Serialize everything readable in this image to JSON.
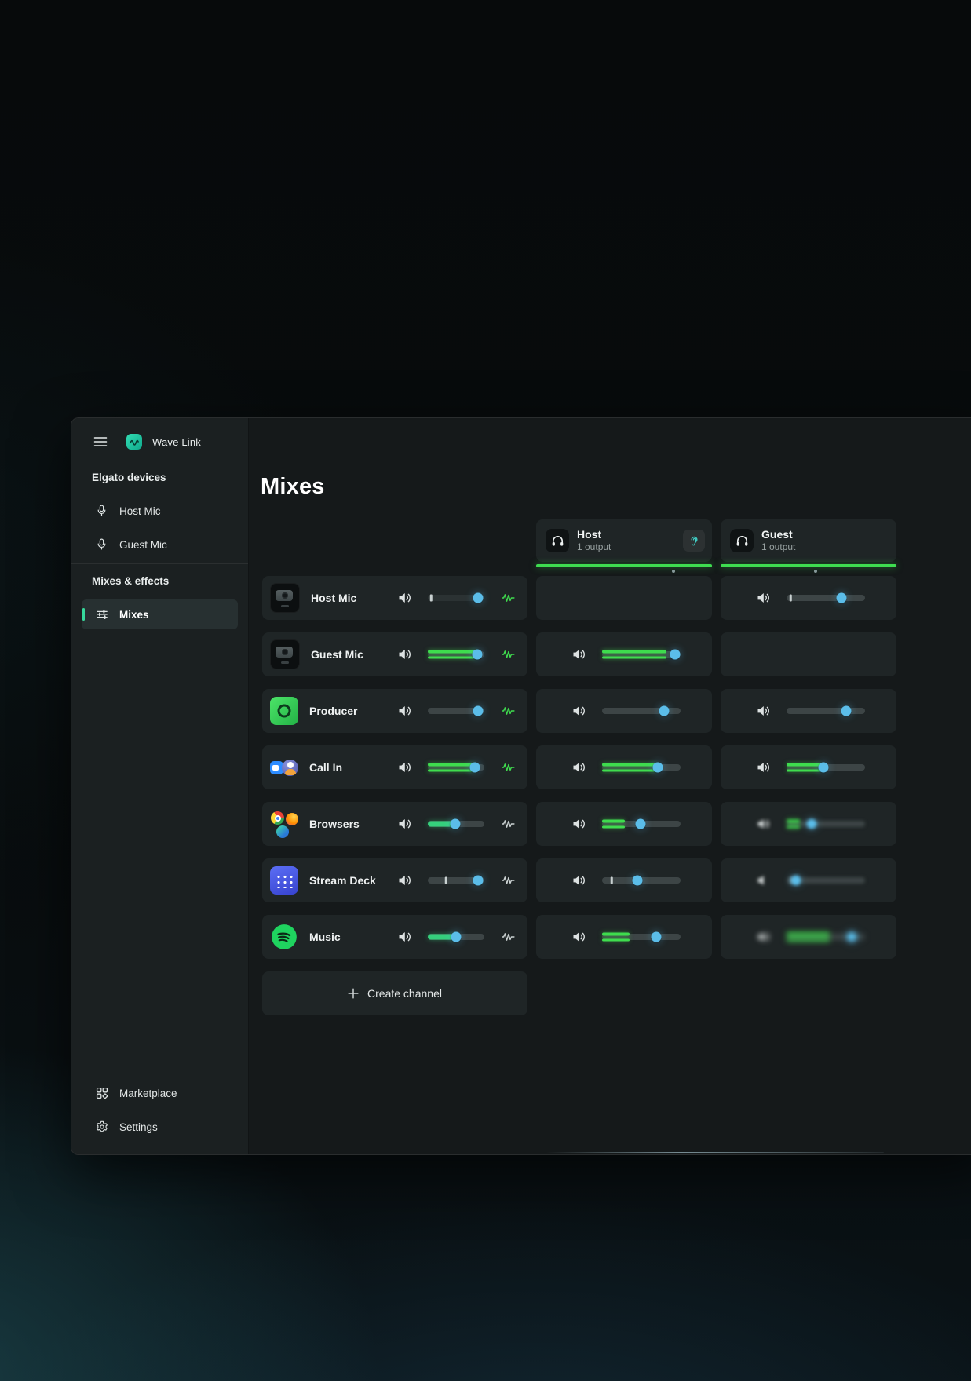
{
  "titlebar": {
    "app_title": "Wave Link"
  },
  "sidebar": {
    "sections": [
      {
        "label": "Elgato devices",
        "items": [
          {
            "label": "Host Mic",
            "icon": "microphone"
          },
          {
            "label": "Guest Mic",
            "icon": "microphone"
          }
        ]
      },
      {
        "label": "Mixes & effects",
        "items": [
          {
            "label": "Mixes",
            "icon": "mixer-sliders",
            "selected": true
          }
        ]
      }
    ],
    "footer_items": [
      {
        "label": "Marketplace",
        "icon": "marketplace"
      },
      {
        "label": "Settings",
        "icon": "gear"
      }
    ]
  },
  "main": {
    "heading": "Mixes",
    "create_channel": {
      "label": "Create channel",
      "icon": "plus"
    },
    "mixes": [
      {
        "name": "Host",
        "subtitle": "1 output",
        "level_percent": 100,
        "marker_percent": 78,
        "monitoring": true
      },
      {
        "name": "Guest",
        "subtitle": "1 output",
        "level_percent": 100,
        "marker_percent": 54,
        "monitoring": false
      }
    ],
    "channels": [
      {
        "name": "Host Mic",
        "icon": "webcam",
        "wave": "green",
        "monitor": {
          "classes": "has-tick dark",
          "tick": 6,
          "knob": 89
        },
        "host": {
          "classes": "empty"
        },
        "guest": {
          "classes": "has-tick",
          "tick": 5,
          "knob": 70
        }
      },
      {
        "name": "Guest Mic",
        "icon": "webcam",
        "wave": "green",
        "monitor": {
          "classes": "has-meter",
          "fill": 86,
          "knob": 88
        },
        "host": {
          "classes": "has-meter",
          "fill": 82,
          "knob": 93
        },
        "guest": {
          "classes": "empty"
        }
      },
      {
        "name": "Producer",
        "icon": "producer",
        "wave": "green",
        "monitor": {
          "classes": "",
          "knob": 89
        },
        "host": {
          "classes": "",
          "knob": 79
        },
        "guest": {
          "classes": "",
          "knob": 76
        }
      },
      {
        "name": "Call In",
        "icon": "callin",
        "wave": "green",
        "monitor": {
          "classes": "has-meter",
          "fill": 82,
          "knob": 84
        },
        "host": {
          "classes": "has-meter",
          "fill": 69,
          "knob": 71
        },
        "guest": {
          "classes": "has-meter",
          "fill": 43,
          "knob": 47
        }
      },
      {
        "name": "Browsers",
        "icon": "browsers",
        "wave": "dim",
        "monitor": {
          "classes": "has-fill",
          "fill": 49,
          "knob": 49
        },
        "host": {
          "classes": "has-meter",
          "fill": 29,
          "knob": 49
        },
        "guest": {
          "classes": "has-meter blur-2",
          "fill": 17,
          "knob": 32
        }
      },
      {
        "name": "Stream Deck",
        "icon": "streamdeck",
        "wave": "dim",
        "monitor": {
          "classes": "has-tick",
          "tick": 32,
          "knob": 89
        },
        "host": {
          "classes": "has-tick",
          "tick": 12,
          "knob": 45
        },
        "guest": {
          "classes": "has-tick blur-2 muted",
          "tick": 6,
          "knob": 12
        }
      },
      {
        "name": "Music",
        "icon": "spotify",
        "wave": "dim",
        "monitor": {
          "classes": "has-fill",
          "fill": 50,
          "knob": 50
        },
        "host": {
          "classes": "has-meter",
          "fill": 35,
          "knob": 69
        },
        "guest": {
          "classes": "has-meter blur-3",
          "fill": 55,
          "knob": 83
        }
      }
    ]
  },
  "colors": {
    "meter_green": "#3fdd4e",
    "fill_teal_green": "#35d07c",
    "knob_blue": "#5bbde9",
    "accent_teal": "#36d99c",
    "window_bg": "#15191a",
    "cell_bg": "#1f2526"
  }
}
